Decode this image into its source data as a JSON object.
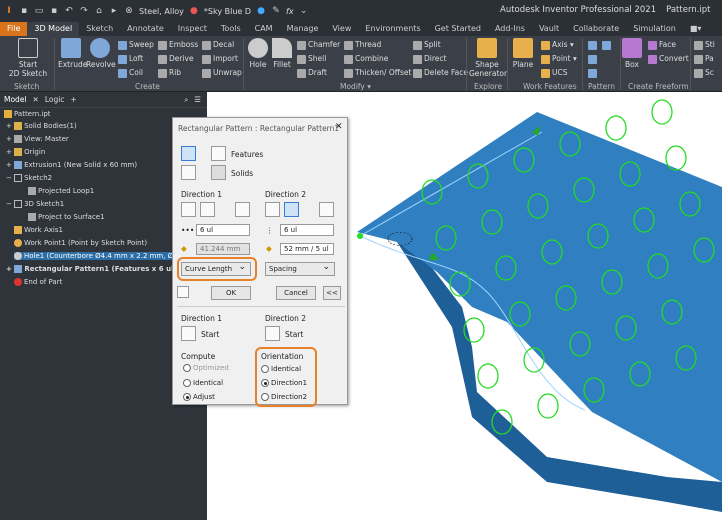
{
  "qat": {
    "material": "Steel, Alloy",
    "appearance": "*Sky Blue D",
    "fx": "fx",
    "title": "Autodesk Inventor Professional 2021",
    "file": "Pattern.ipt"
  },
  "tabs": [
    "File",
    "3D Model",
    "Sketch",
    "Annotate",
    "Inspect",
    "Tools",
    "CAM",
    "Manage",
    "View",
    "Environments",
    "Get Started",
    "Add-Ins",
    "Vault",
    "Collaborate",
    "Simulation"
  ],
  "ribbon": {
    "start_sketch": "Start\n2D Sketch",
    "sketch_group": "Sketch",
    "extrude": "Extrude",
    "revolve": "Revolve",
    "sweep": "Sweep",
    "loft": "Loft",
    "coil": "Coil",
    "emboss": "Emboss",
    "derive": "Derive",
    "rib": "Rib",
    "decal": "Decal",
    "import": "Import",
    "unwrap": "Unwrap",
    "create_group": "Create",
    "hole": "Hole",
    "fillet": "Fillet",
    "chamfer": "Chamfer",
    "shell": "Shell",
    "draft": "Draft",
    "thread": "Thread",
    "combine": "Combine",
    "thicken": "Thicken/ Offset",
    "split": "Split",
    "direct": "Direct",
    "delete_face": "Delete Face",
    "modify_group": "Modify ▾",
    "shape_generator": "Shape\nGenerator",
    "explore_group": "Explore",
    "plane": "Plane",
    "axis": "Axis",
    "point": "Point",
    "ucs": "UCS",
    "work_group": "Work Features",
    "pattern_group": "Pattern",
    "box": "Box",
    "face": "Face",
    "convert": "Convert",
    "freeform_group": "Create Freeform",
    "sti": "Sti",
    "pa": "Pa",
    "sc": "Sc"
  },
  "browser": {
    "tabs": [
      "Model",
      "Logic"
    ],
    "nodes": [
      "Pattern.ipt",
      "Solid Bodies(1)",
      "View: Master",
      "Origin",
      "Extrusion1 (New Solid x 60 mm)",
      "Sketch2",
      "Projected Loop1",
      "3D Sketch1",
      "Project to Surface1",
      "Work Axis1",
      "Work Point1 (Point by Sketch Point)",
      "Hole1 (Counterbore Ø4.4 mm x 2.2 mm, Ø3 mm Through)",
      "Rectangular Pattern1 (Features x 6 ul, x 6 ul)",
      "End of Part"
    ]
  },
  "dialog": {
    "title": "Rectangular Pattern : Rectangular Pattern1",
    "features": "Features",
    "solids": "Solids",
    "direction1": "Direction 1",
    "direction2": "Direction 2",
    "count1": "6 ul",
    "count2": "6 ul",
    "length1": "41.244 mm",
    "spacing2": "52 mm / 5 ul",
    "mode1": "Curve Length",
    "mode2": "Spacing",
    "ok": "OK",
    "cancel": "Cancel",
    "more": "<<",
    "start_dir1": "Direction 1",
    "start_dir2": "Direction 2",
    "start": "Start",
    "compute": "Compute",
    "optimized": "Optimized",
    "identical": "Identical",
    "adjust": "Adjust",
    "orientation": "Orientation",
    "o_identical": "Identical",
    "o_direction1": "Direction1",
    "o_direction2": "Direction2"
  },
  "colors": {
    "accent": "#e8822a",
    "body": "#2f7fc1",
    "hole": "#22dd22",
    "select": "#2b6ea5"
  }
}
